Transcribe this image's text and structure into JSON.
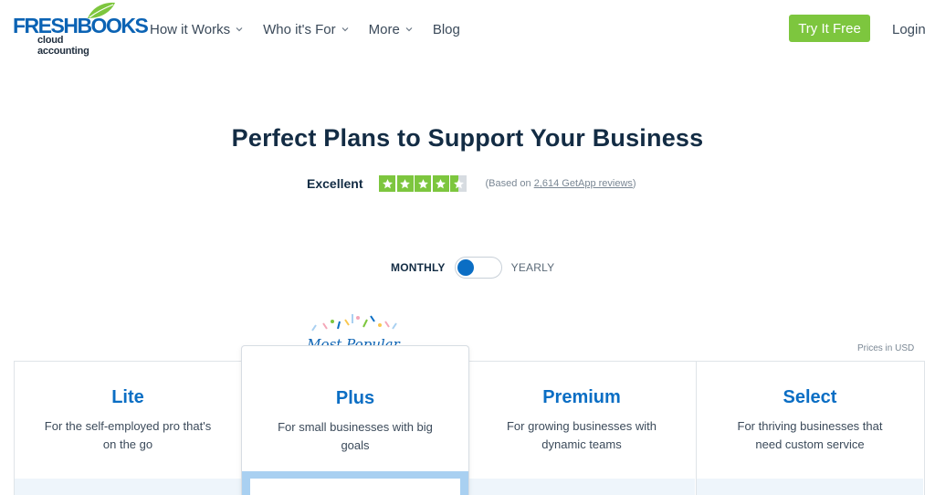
{
  "brand": {
    "logo_word": "FRESHBOOKS",
    "logo_sub": "cloud accounting",
    "logo_color": "#0b63b4",
    "leaf_color": "#7dc63e"
  },
  "nav": {
    "items": [
      {
        "label": "How it Works",
        "has_dropdown": true
      },
      {
        "label": "Who it's For",
        "has_dropdown": true
      },
      {
        "label": "More",
        "has_dropdown": true
      },
      {
        "label": "Blog",
        "has_dropdown": false
      }
    ],
    "cta_label": "Try It Free",
    "cta_color": "#7dc63e",
    "login_label": "Login"
  },
  "hero": {
    "title": "Perfect Plans to Support Your Business",
    "rating_label": "Excellent",
    "rating_stars": 4.5,
    "rating_max": 5,
    "reviews_prefix": "(Based on ",
    "reviews_link": "2,614 GetApp reviews",
    "reviews_suffix": ")"
  },
  "billing": {
    "monthly_label": "MONTHLY",
    "yearly_label": "YEARLY",
    "selected": "monthly"
  },
  "popular_badge": "Most Popular",
  "prices_note": "Prices in USD",
  "plans": [
    {
      "name": "Lite",
      "desc": "For the self-employed pro that's on the go"
    },
    {
      "name": "Plus",
      "desc": "For small businesses with big goals"
    },
    {
      "name": "Premium",
      "desc": "For growing businesses with dynamic teams"
    },
    {
      "name": "Select",
      "desc": "For thriving businesses that need custom service"
    }
  ],
  "accent_color": "#0b6ec4"
}
